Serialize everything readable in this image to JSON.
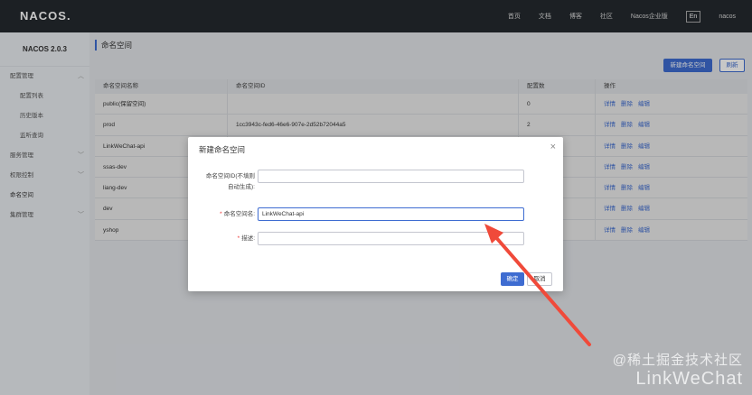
{
  "topbar": {
    "logo": "NACOS.",
    "nav": [
      "首页",
      "文档",
      "博客",
      "社区",
      "Nacos企业版"
    ],
    "lang": "En",
    "user": "nacos"
  },
  "sidebar": {
    "version": "NACOS 2.0.3",
    "items": [
      {
        "label": "配置管理",
        "chevron": "︿"
      },
      {
        "label": "配置列表"
      },
      {
        "label": "历史版本"
      },
      {
        "label": "监听查询"
      },
      {
        "label": "服务管理",
        "chevron": "﹀"
      },
      {
        "label": "权限控制",
        "chevron": "﹀"
      },
      {
        "label": "命名空间"
      },
      {
        "label": "集群管理",
        "chevron": "﹀"
      }
    ]
  },
  "main": {
    "title": "命名空间",
    "new_button": "新建命名空间",
    "refresh_button": "刷新",
    "columns": [
      "命名空间名称",
      "命名空间ID",
      "配置数",
      "操作"
    ],
    "rows": [
      {
        "name": "public(保留空间)",
        "id": "",
        "count": "0"
      },
      {
        "name": "prod",
        "id": "1cc3943c-fed6-46e6-907e-2d52b72044a5",
        "count": "2"
      },
      {
        "name": "LinkWeChat-api",
        "id": "",
        "count": ""
      },
      {
        "name": "ssas-dev",
        "id": "",
        "count": ""
      },
      {
        "name": "liang-dev",
        "id": "",
        "count": ""
      },
      {
        "name": "dev",
        "id": "",
        "count": ""
      },
      {
        "name": "yshop",
        "id": "",
        "count": ""
      }
    ],
    "actions": [
      "详情",
      "删除",
      "编辑"
    ]
  },
  "modal": {
    "title": "新建命名空间",
    "close": "×",
    "id_label_1": "命名空间ID(不填则",
    "id_label_2": "自动生成):",
    "id_value": "",
    "name_label": "命名空间名:",
    "name_value": "LinkWeChat-api",
    "desc_label": "描述:",
    "desc_value": "",
    "required_mark": "*",
    "ok_button": "确定",
    "cancel_button": "取消"
  },
  "watermark": {
    "line1": "@稀土掘金技术社区",
    "line2": "LinkWeChat"
  },
  "colors": {
    "accent": "#3e6cd1",
    "annotation_arrow": "#f04a3a"
  }
}
